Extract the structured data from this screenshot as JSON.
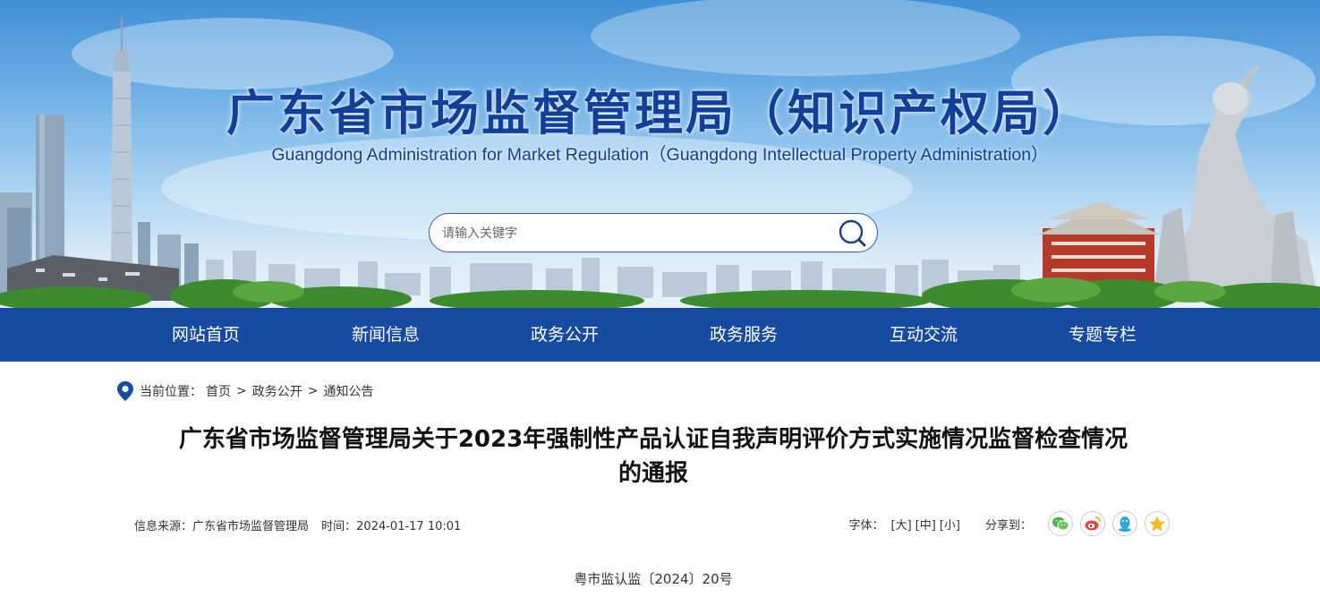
{
  "banner": {
    "title": "广东省市场监督管理局（知识产权局）",
    "subtitle": "Guangdong Administration for Market Regulation（Guangdong Intellectual Property Administration）"
  },
  "search": {
    "placeholder": "请输入关键字",
    "value": ""
  },
  "nav": {
    "items": [
      {
        "label": "网站首页"
      },
      {
        "label": "新闻信息"
      },
      {
        "label": "政务公开"
      },
      {
        "label": "政务服务"
      },
      {
        "label": "互动交流"
      },
      {
        "label": "专题专栏"
      }
    ]
  },
  "breadcrumb": {
    "prefix": "当前位置：",
    "items": [
      "首页",
      "政务公开",
      "通知公告"
    ],
    "separator": ">"
  },
  "article": {
    "title_line1": "广东省市场监督管理局关于2023年强制性产品认证自我声明评价方式实施情况监督检查情况",
    "title_line2": "的通报",
    "source_label": "信息来源：广东省市场监督管理局",
    "time_label": "时间：2024-01-17 10:01",
    "font_label": "字体：",
    "font_large": "[大]",
    "font_medium": "[中]",
    "font_small": "[小]",
    "share_label": "分享到：",
    "doc_number": "粤市监认监〔2024〕20号"
  },
  "colors": {
    "nav_bg": "#174aa1",
    "title_blue": "#123f99",
    "wechat": "#4caf50",
    "weibo": "#e6483c",
    "qq": "#2ea7e0",
    "qzone": "#f5b921"
  },
  "icons": [
    "search-icon",
    "location-icon",
    "wechat-icon",
    "weibo-icon",
    "qq-icon",
    "qzone-icon"
  ]
}
